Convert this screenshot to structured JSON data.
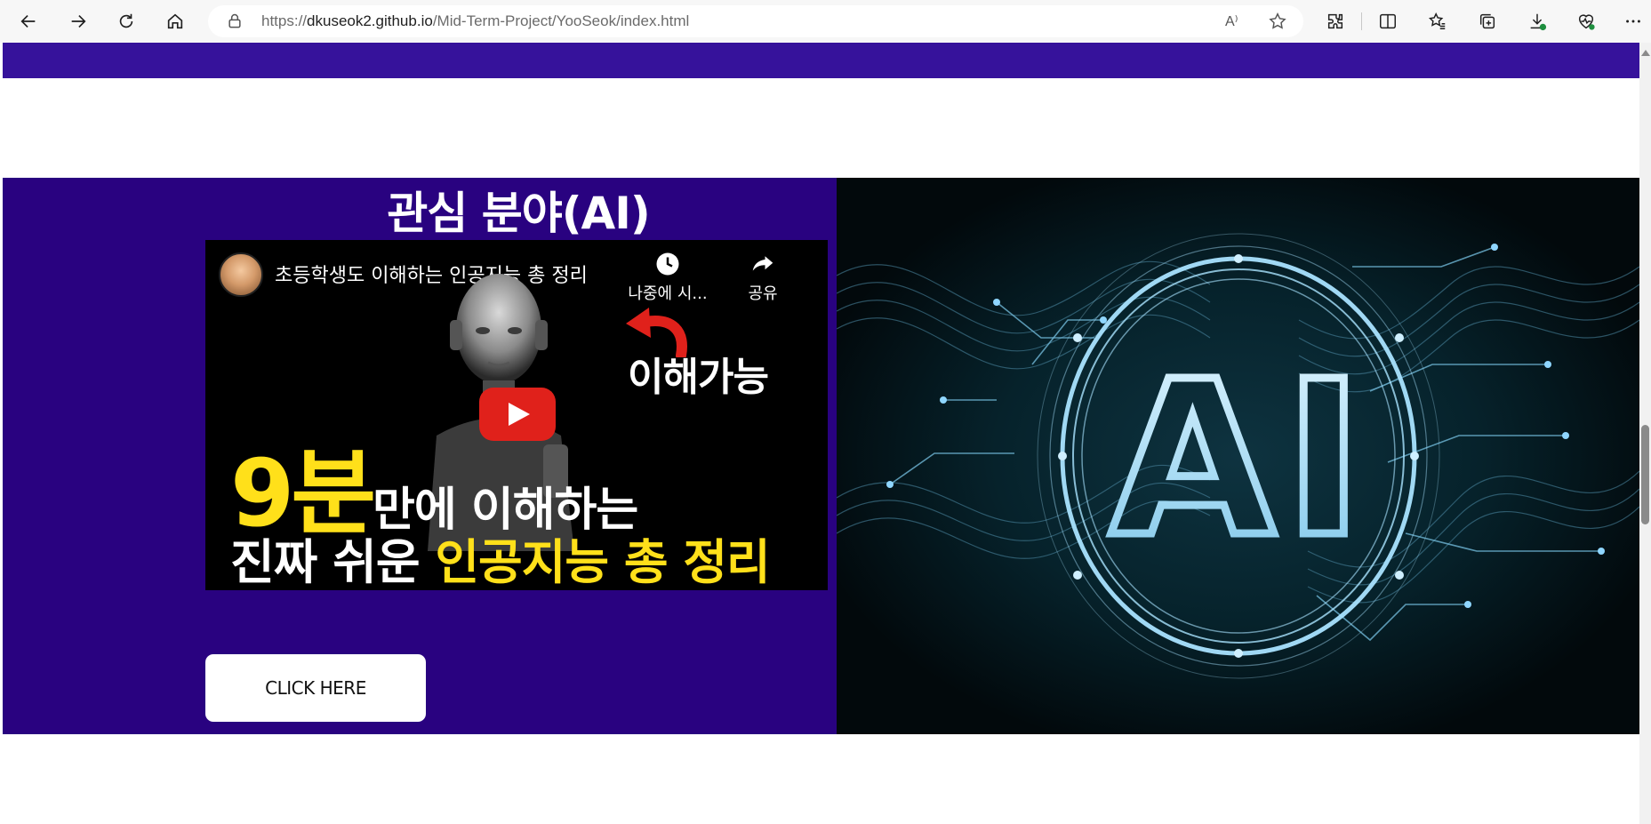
{
  "browser": {
    "url_prefix": "https://",
    "url_host": "dkuseok2.github.io",
    "url_path": "/Mid-Term-Project/YooSeok/index.html",
    "read_aloud_label": "A⁾",
    "icons": [
      "back-icon",
      "forward-icon",
      "refresh-icon",
      "home-icon",
      "lock-icon",
      "read-aloud-icon",
      "favorite-star-icon",
      "extensions-icon",
      "split-screen-icon",
      "favorites-icon",
      "collections-icon",
      "downloads-icon",
      "browser-essentials-icon",
      "more-icon"
    ]
  },
  "section": {
    "title": "관심 분야(AI)",
    "cta_label": "CLICK HERE",
    "left_bg": "#290280",
    "top_band_bg": "#36129b"
  },
  "video": {
    "title": "초등학생도 이해하는 인공지능 총 정리",
    "watch_later_label": "나중에 시...",
    "share_label": "공유",
    "annotation": "이해가능",
    "headline_big": "9분",
    "headline_rest": "만에 이해하는",
    "headline2_white": "진짜 쉬운 ",
    "headline2_yellow": "인공지능 총 정리",
    "accent_yellow": "#ffe01a",
    "play_red": "#e0211b"
  },
  "image": {
    "label": "AI",
    "glow": "#8fd6ff"
  }
}
